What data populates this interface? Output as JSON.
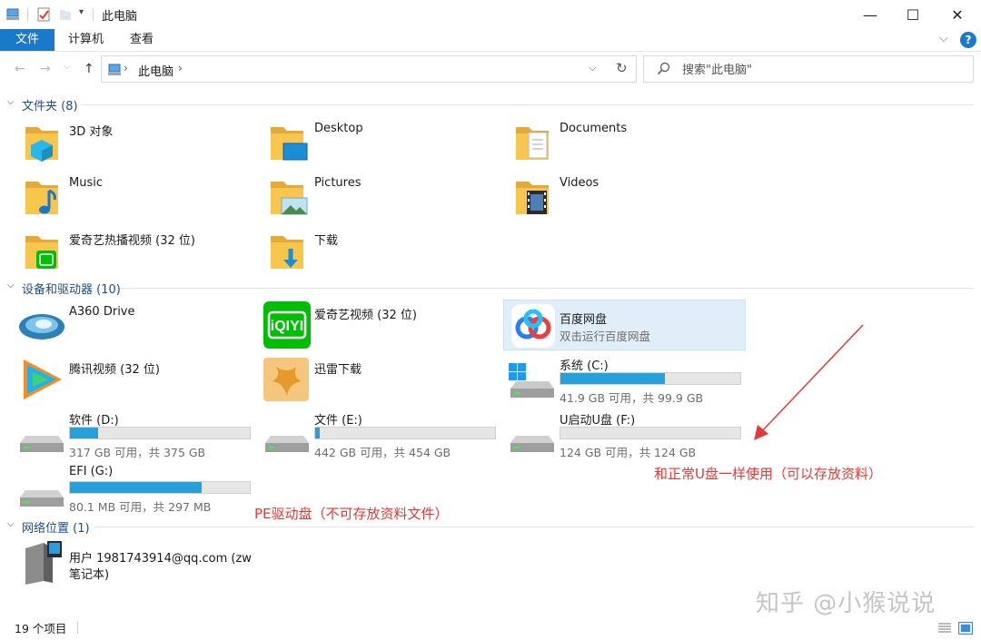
{
  "window": {
    "title": "此电脑",
    "minimize": "—",
    "maximize": "☐",
    "close": "✕"
  },
  "ribbon": {
    "tabs": [
      "文件",
      "计算机",
      "查看"
    ],
    "expand": "⌵",
    "help": "?"
  },
  "nav": {
    "back": "←",
    "forward": "→",
    "up": "↑",
    "breadcrumb_sep": "›",
    "location": "此电脑",
    "dropdown": "⌵",
    "refresh": "↻",
    "search_placeholder": "搜索\"此电脑\""
  },
  "groups": {
    "folders": {
      "chevron": "⌵",
      "label": "文件夹 (8)"
    },
    "devices": {
      "chevron": "⌵",
      "label": "设备和驱动器 (10)"
    },
    "network": {
      "chevron": "⌵",
      "label": "网络位置 (1)"
    }
  },
  "folders": [
    {
      "name": "3D 对象"
    },
    {
      "name": "Desktop"
    },
    {
      "name": "Documents"
    },
    {
      "name": "Music"
    },
    {
      "name": "Pictures"
    },
    {
      "name": "Videos"
    },
    {
      "name": "爱奇艺热播视频 (32 位)"
    },
    {
      "name": "下载"
    }
  ],
  "devices": [
    {
      "name": "A360 Drive"
    },
    {
      "name": "爱奇艺视频 (32 位)"
    },
    {
      "name": "百度网盘",
      "subtitle": "双击运行百度网盘"
    },
    {
      "name": "腾讯视频 (32 位)"
    },
    {
      "name": "迅雷下载"
    }
  ],
  "drives": [
    {
      "name": "系统 (C:)",
      "info": "41.9 GB 可用，共 99.9 GB",
      "used_fraction": 0.58
    },
    {
      "name": "软件 (D:)",
      "info": "317 GB 可用，共 375 GB",
      "used_fraction": 0.155
    },
    {
      "name": "文件 (E:)",
      "info": "442 GB 可用，共 454 GB",
      "used_fraction": 0.027
    },
    {
      "name": "U启动U盘 (F:)",
      "info": "124 GB 可用，共 124 GB",
      "used_fraction": 0.0
    },
    {
      "name": "EFI (G:)",
      "info": "80.1 MB 可用，共 297 MB",
      "used_fraction": 0.73
    }
  ],
  "network_items": [
    {
      "line1": "用户 1981743914@qq.com (zw",
      "line2": "笔记本)"
    }
  ],
  "annotations": {
    "usb_note": "和正常U盘一样使用（可以存放资料）",
    "pe_note": "PE驱动盘（不可存放资料文件）"
  },
  "watermark": "知乎 @小猴说说",
  "status": {
    "item_count": "19 个项目"
  },
  "colors": {
    "accent": "#1979ca",
    "drive_fill": "#26a0da",
    "annotation": "#e53935",
    "folder": "#f8c64c"
  }
}
